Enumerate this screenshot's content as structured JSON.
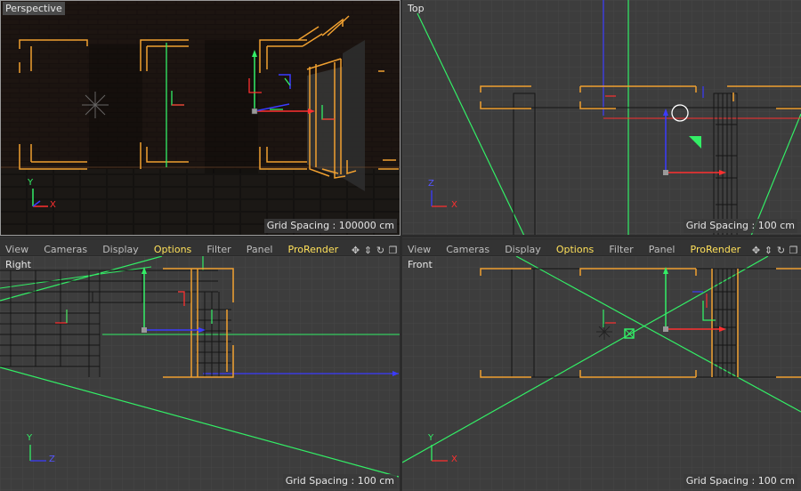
{
  "viewports": {
    "perspective": {
      "label": "Perspective",
      "grid": "Grid Spacing : 100000 cm"
    },
    "top": {
      "label": "Top",
      "grid": "Grid Spacing : 100 cm"
    },
    "right": {
      "label": "Right",
      "grid": "Grid Spacing : 100 cm"
    },
    "front": {
      "label": "Front",
      "grid": "Grid Spacing : 100 cm"
    }
  },
  "menu": {
    "view": "View",
    "cameras": "Cameras",
    "display": "Display",
    "options": "Options",
    "filter": "Filter",
    "panel": "Panel",
    "prorender": "ProRender"
  },
  "tools": [
    "move-view-icon",
    "dolly-view-icon",
    "rotate-view-icon",
    "toggle-layout-icon"
  ],
  "axis": {
    "x": "X",
    "y": "Y",
    "z": "Z"
  },
  "colors": {
    "highlight": "#ffe15a",
    "orange": "#f0a030",
    "green": "#33ff66",
    "red": "#ff3030",
    "blue": "#3030ff"
  }
}
